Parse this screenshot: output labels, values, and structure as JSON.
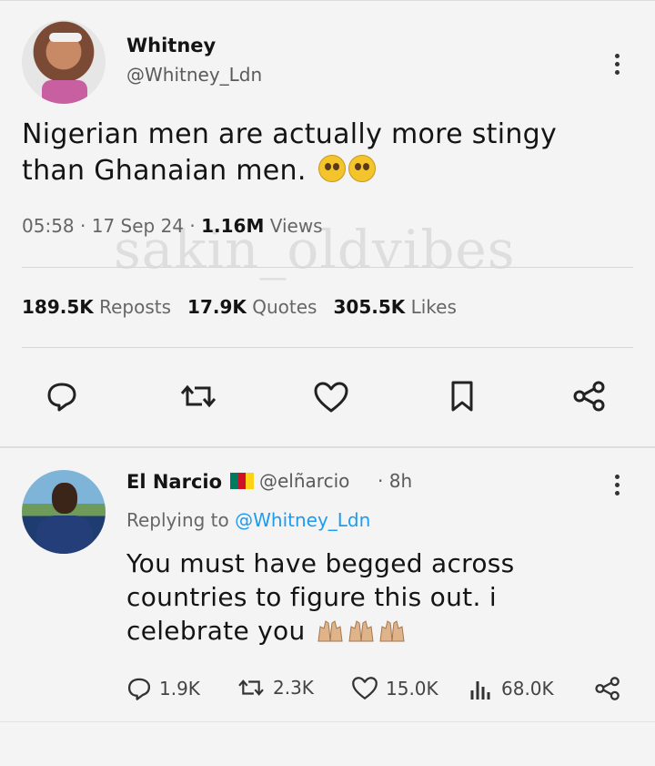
{
  "tweet": {
    "author_name": "Whitney",
    "author_handle": "@Whitney_Ldn",
    "text": "Nigerian men are actually more stingy than Ghanaian men.",
    "emojis": [
      "pleading-face",
      "pleading-face"
    ],
    "time": "05:58",
    "date": "17 Sep 24",
    "views_count": "1.16M",
    "views_label": "Views",
    "reposts_count": "189.5K",
    "reposts_label": "Reposts",
    "quotes_count": "17.9K",
    "quotes_label": "Quotes",
    "likes_count": "305.5K",
    "likes_label": "Likes",
    "actions": [
      "reply-icon",
      "repost-icon",
      "like-icon",
      "bookmark-icon",
      "share-icon"
    ]
  },
  "watermark": "sakin_oldvibes",
  "reply": {
    "author_name": "El Narcio",
    "author_handle": "@elñarcio",
    "time": "8h",
    "replying_prefix": "Replying to",
    "replying_handle": "@Whitney_Ldn",
    "text": "You must have begged across countries to figure this out. i celebrate you",
    "emoji": "raising-hands",
    "replies": "1.9K",
    "reposts": "2.3K",
    "likes": "15.0K",
    "views": "68.0K"
  },
  "colors": {
    "link": "#1d9bf0",
    "flag": [
      "#007a5e",
      "#ce1126",
      "#fcd116"
    ]
  }
}
